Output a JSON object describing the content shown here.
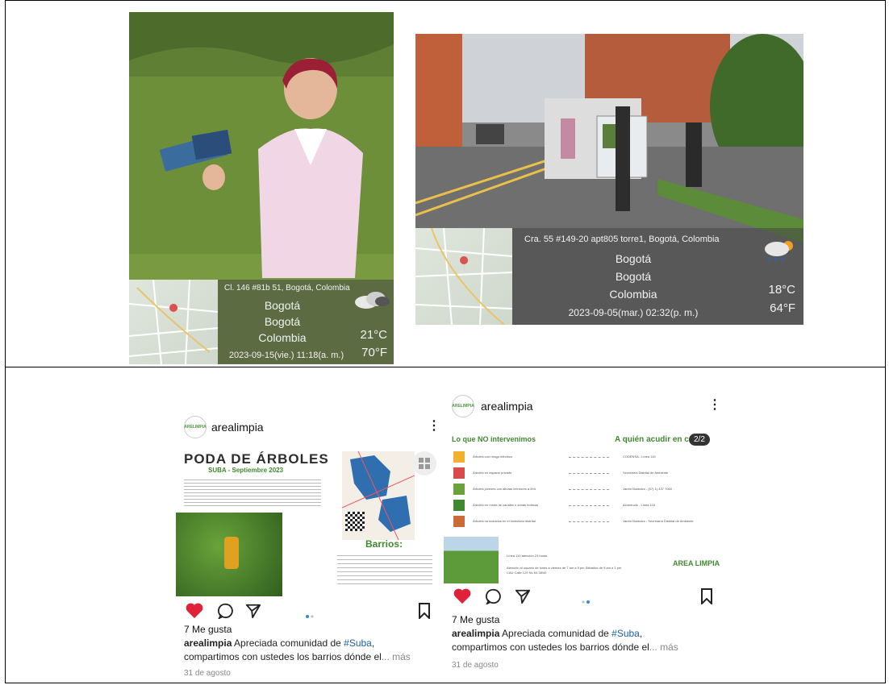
{
  "photo1": {
    "address": "Cl. 146 #81b 51, Bogotá, Colombia",
    "city": "Bogotá",
    "region": "Bogotá",
    "country": "Colombia",
    "temp_c": "21°C",
    "temp_f": "70°F",
    "datetime": "2023-09-15(vie.)  11:18(a. m.)"
  },
  "photo2": {
    "address": "Cra. 55 #149-20 apt805 torre1, Bogotá, Colombia",
    "city": "Bogotá",
    "region": "Bogotá",
    "country": "Colombia",
    "temp_c": "18°C",
    "temp_f": "64°F",
    "datetime": "2023-09-05(mar.)  02:32(p. m.)"
  },
  "post1": {
    "username": "arealimpia",
    "avatar_text": "ARELIMPIA",
    "poster_title": "PODA DE ÁRBOLES",
    "poster_subtitle": "SUBA - Septiembre 2023",
    "barrios_label": "Barrios:",
    "likes": "7 Me gusta",
    "caption_user": "arealimpia",
    "caption_pre": " Apreciada comunidad de ",
    "caption_tag": "#Suba",
    "caption_post": ",",
    "caption_line2": "compartimos con ustedes los barrios dónde el",
    "caption_more": "... más",
    "date": "31 de agosto"
  },
  "post2": {
    "username": "arealimpia",
    "avatar_text": "ARELIMPIA",
    "counter": "2/2",
    "left_heading": "Lo que NO intervenimos",
    "right_heading": "A quién acudir en c",
    "rows": [
      {
        "left": "Árboles con riesgo eléctrico",
        "right": "CODENSA - Línea 115"
      },
      {
        "left": "Árboles en espacio privado",
        "right": "Secretaría Distrital de Ambiente"
      },
      {
        "left": "Árboles jóvenes con alturas inferiores a 2mt",
        "right": "Jardín Botánico - (57) 1) 437 7060"
      },
      {
        "left": "Árboles en ronda de canales o zonas hídricas",
        "right": "Acueducto - Línea 116"
      },
      {
        "left": "Árboles no incluidos en el inventario distrital",
        "right": "Jardín Botánico - Secretaría Distrital de Ambiente"
      }
    ],
    "footer_line1": "Línea 110 atención 24 horas",
    "footer_line2": "Atención al usuario de lunes a viernes de 7 am a 5 pm Sábados de 9 am a 1 pm",
    "footer_line3": "CAU Calle 129 No 54 38/40",
    "logo": "AREA LIMPIA",
    "likes": "7 Me gusta",
    "caption_user": "arealimpia",
    "caption_pre": " Apreciada comunidad de ",
    "caption_tag": "#Suba",
    "caption_post": ",",
    "caption_line2": "compartimos con ustedes los barrios dónde el",
    "caption_more": "... más",
    "date": "31 de agosto"
  },
  "colors": {
    "like_red": "#e0213a",
    "poster_green": "#3f8a2e",
    "map_blue": "#2f6fb0"
  }
}
